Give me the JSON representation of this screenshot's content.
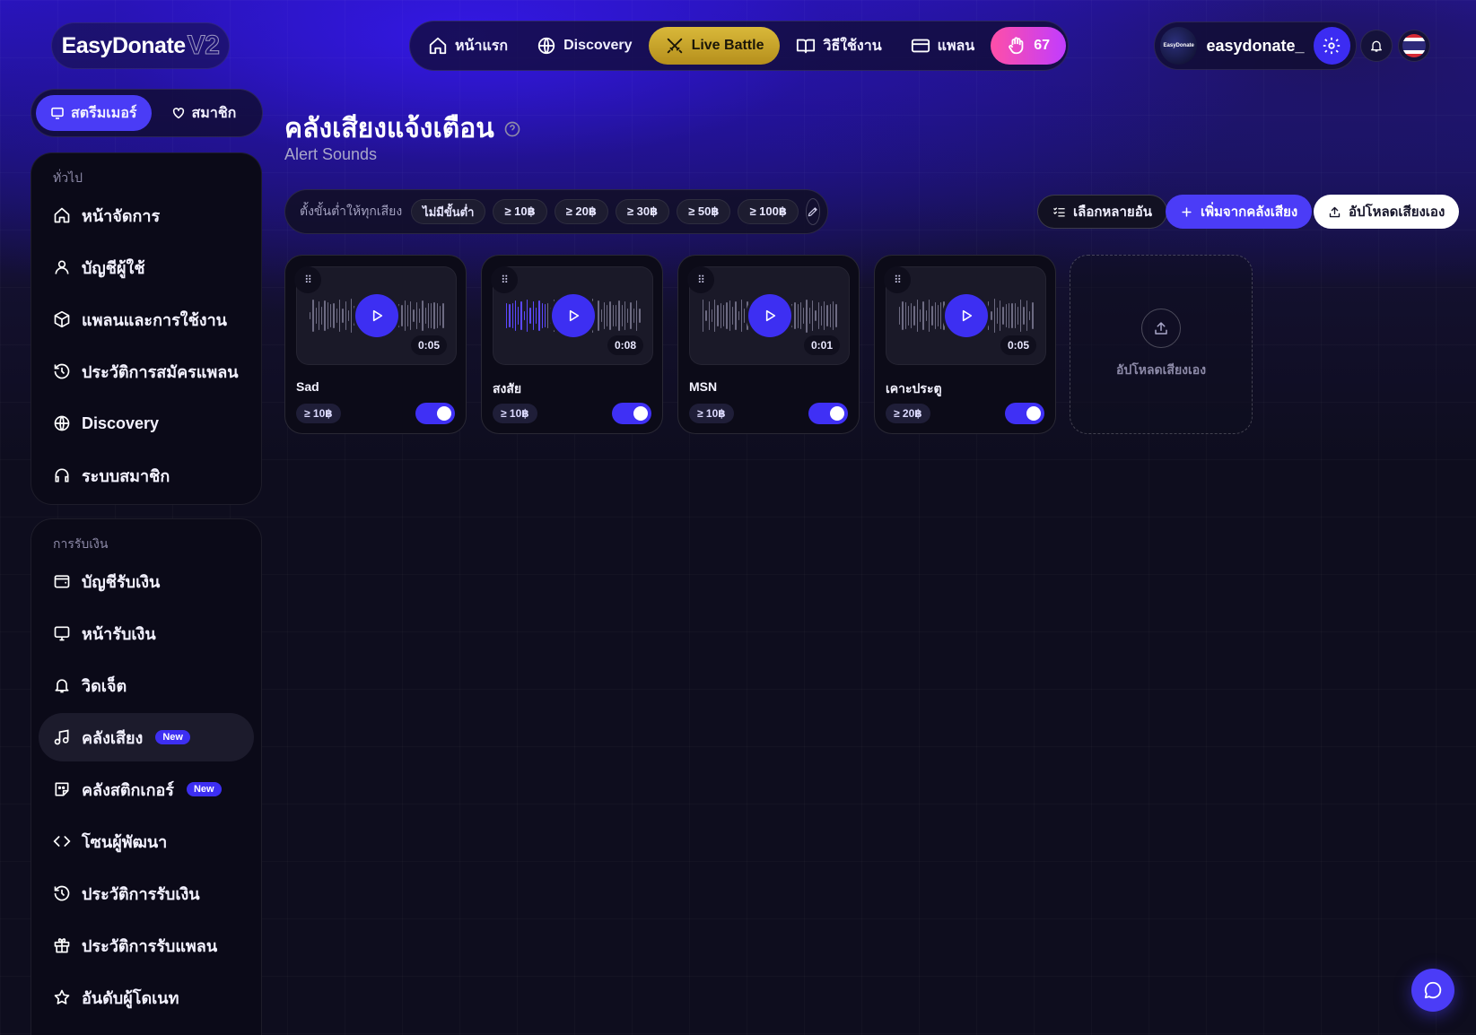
{
  "brand": {
    "name": "EasyDonate",
    "version": "V2"
  },
  "topnav": {
    "items": [
      {
        "label": "หน้าแรก",
        "icon": "home-icon"
      },
      {
        "label": "Discovery",
        "icon": "globe-icon"
      },
      {
        "label": "Live Battle",
        "icon": "swords-icon"
      },
      {
        "label": "วิธีใช้งาน",
        "icon": "book-icon"
      },
      {
        "label": "แพลน",
        "icon": "card-icon"
      }
    ],
    "points": "67"
  },
  "user": {
    "avatar_text": "EasyDonate",
    "name": "easydonate_"
  },
  "role_toggle": {
    "streamer": "สตรีมเมอร์",
    "member": "สมาชิก",
    "active": "streamer"
  },
  "sidebar": {
    "general": {
      "title": "ทั่วไป",
      "items": [
        {
          "label": "หน้าจัดการ",
          "icon": "home-icon"
        },
        {
          "label": "บัญชีผู้ใช้",
          "icon": "user-icon"
        },
        {
          "label": "แพลนและการใช้งาน",
          "icon": "box-icon"
        },
        {
          "label": "ประวัติการสมัครแพลน",
          "icon": "history-icon"
        },
        {
          "label": "Discovery",
          "icon": "globe-icon"
        },
        {
          "label": "ระบบสมาชิก",
          "icon": "headset-icon"
        }
      ]
    },
    "payments": {
      "title": "การรับเงิน",
      "items": [
        {
          "label": "บัญชีรับเงิน",
          "icon": "wallet-icon"
        },
        {
          "label": "หน้ารับเงิน",
          "icon": "monitor-icon"
        },
        {
          "label": "วิดเจ็ต",
          "icon": "bell-icon"
        },
        {
          "label": "คลังเสียง",
          "icon": "music-icon",
          "badge": "New",
          "active": true
        },
        {
          "label": "คลังสติกเกอร์",
          "icon": "sticker-icon",
          "badge": "New"
        },
        {
          "label": "โซนผู้พัฒนา",
          "icon": "code-icon"
        },
        {
          "label": "ประวัติการรับเงิน",
          "icon": "history-icon"
        },
        {
          "label": "ประวัติการรับแพลน",
          "icon": "gift-icon"
        },
        {
          "label": "อันดับผู้โดเนท",
          "icon": "star-icon"
        }
      ]
    }
  },
  "page": {
    "title": "คลังเสียงแจ้งเตือน",
    "subtitle": "Alert Sounds"
  },
  "filter": {
    "label": "ตั้งขั้นต่ำให้ทุกเสียง",
    "chips": [
      "ไม่มีขั้นต่ำ",
      "≥ 10฿",
      "≥ 20฿",
      "≥ 30฿",
      "≥ 50฿",
      "≥ 100฿"
    ]
  },
  "actions": {
    "multi_select": "เลือกหลายอัน",
    "add_from_library": "เพิ่มจากคลังเสียง",
    "upload_own": "อัปโหลดเสียงเอง"
  },
  "sounds": [
    {
      "name": "Sad",
      "duration": "0:05",
      "min": "≥ 10฿",
      "enabled": true,
      "progress": 0
    },
    {
      "name": "สงสัย",
      "duration": "0:08",
      "min": "≥ 10฿",
      "enabled": true,
      "progress": 0.3
    },
    {
      "name": "MSN",
      "duration": "0:01",
      "min": "≥ 10฿",
      "enabled": true,
      "progress": 0
    },
    {
      "name": "เคาะประตู",
      "duration": "0:05",
      "min": "≥ 20฿",
      "enabled": true,
      "progress": 0
    }
  ],
  "upload_card": {
    "label": "อัปโหลดเสียงเอง"
  },
  "colors": {
    "accent": "#3d2ff2",
    "live": "#d4b031",
    "points": "#ff4fa7"
  }
}
